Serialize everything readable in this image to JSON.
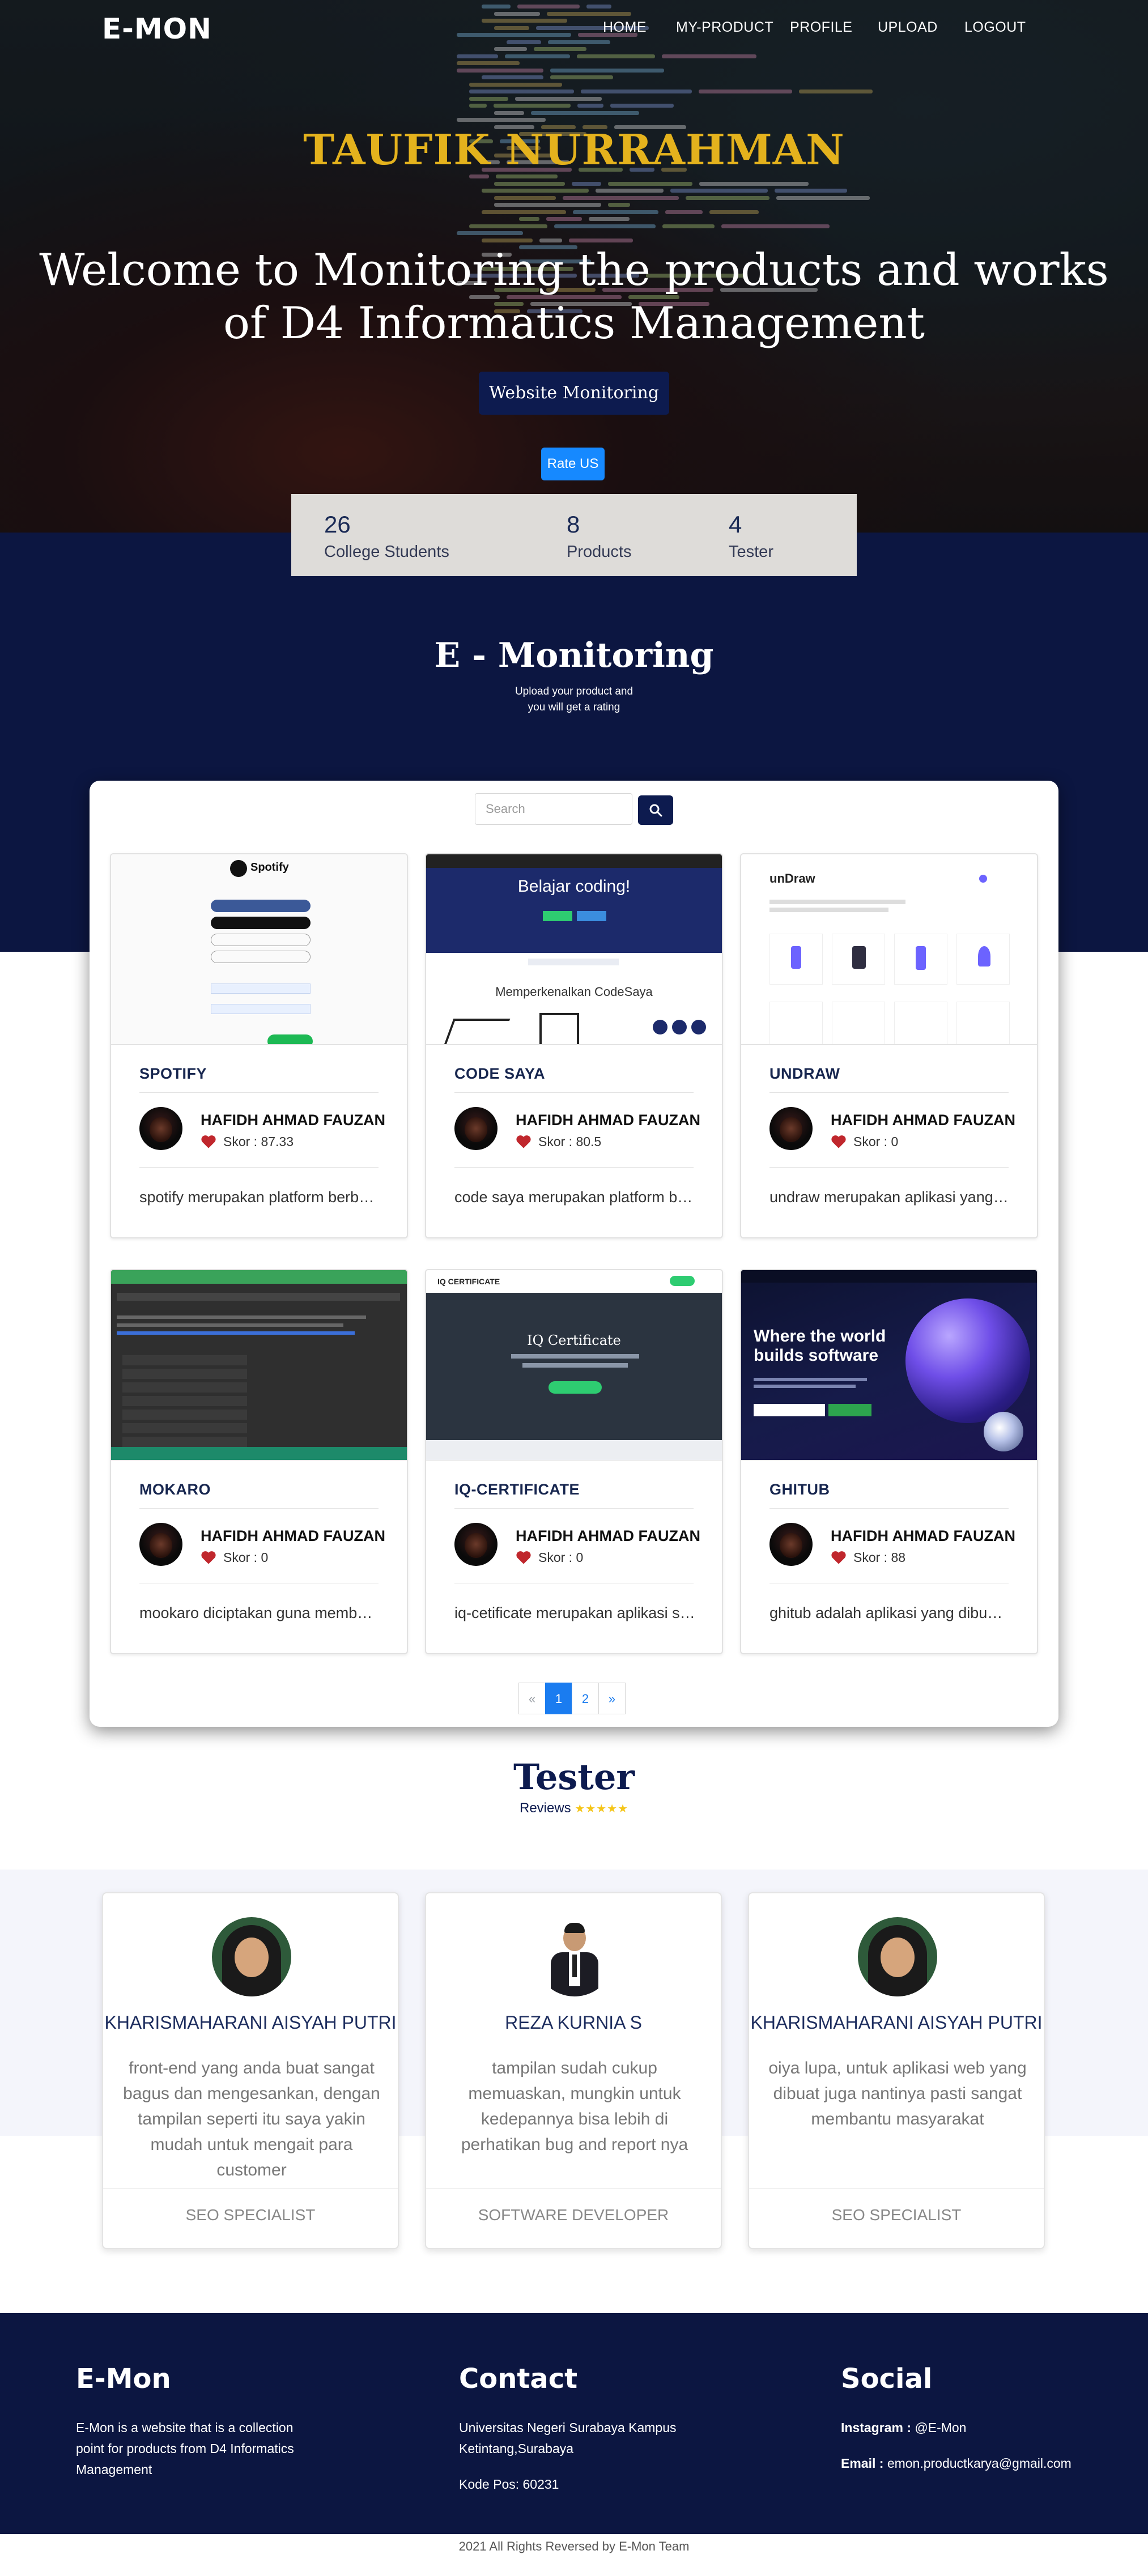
{
  "brand": {
    "logo_text": "E-MON"
  },
  "nav": {
    "items": [
      {
        "label": "HOME"
      },
      {
        "label": "MY-PRODUCT"
      },
      {
        "label": "PROFILE"
      },
      {
        "label": "UPLOAD"
      },
      {
        "label": "LOGOUT"
      }
    ]
  },
  "hero": {
    "name": "TAUFIK NURRAHMAN",
    "title_line1": "Welcome to Monitoring the products and works",
    "title_line2": "of D4 Informatics Management",
    "website_button": "Website Monitoring",
    "rate_button": "Rate US"
  },
  "stats": [
    {
      "value": "26",
      "label": "College Students"
    },
    {
      "value": "8",
      "label": "Products"
    },
    {
      "value": "4",
      "label": "Tester"
    }
  ],
  "monitoring": {
    "title": "E - Monitoring",
    "subtitle_line1": "Upload your product and",
    "subtitle_line2": "you will get a rating"
  },
  "search": {
    "placeholder": "Search",
    "icon": "search-icon"
  },
  "products": [
    {
      "name": "SPOTIFY",
      "owner": "HAFIDH AHMAD FAUZAN",
      "score": "Skor : 87.33",
      "desc": "spotify merupakan platform berbasis musik",
      "thumb": "spotify"
    },
    {
      "name": "CODE SAYA",
      "owner": "HAFIDH AHMAD FAUZAN",
      "score": "Skor : 80.5",
      "desc": "code saya merupakan platform belajar coding",
      "thumb": "codesaya"
    },
    {
      "name": "UNDRAW",
      "owner": "HAFIDH AHMAD FAUZAN",
      "score": "Skor : 0",
      "desc": "undraw merupakan aplikasi yang menyediakan ilustrasi",
      "thumb": "undraw"
    },
    {
      "name": "MOKARO",
      "owner": "HAFIDH AHMAD FAUZAN",
      "score": "Skor : 0",
      "desc": "mookaro diciptakan guna membantu",
      "thumb": "mokaro"
    },
    {
      "name": "IQ-CERTIFICATE",
      "owner": "HAFIDH AHMAD FAUZAN",
      "score": "Skor : 0",
      "desc": "iq-cetificate merupakan aplikasi sertifikat",
      "thumb": "iqcert"
    },
    {
      "name": "GHITUB",
      "owner": "HAFIDH AHMAD FAUZAN",
      "score": "Skor : 88",
      "desc": "ghitub adalah aplikasi yang dibuat untuk",
      "thumb": "github"
    }
  ],
  "thumb_text": {
    "spotify_logo": "Spotify",
    "codesaya_heading": "Belajar coding!",
    "codesaya_sub": "Memperkenalkan CodeSaya",
    "undraw_logo": "unDraw",
    "iqcert_logo": "IQ CERTIFICATE",
    "iqcert_heading": "IQ Certificate",
    "github_heading1": "Where the world",
    "github_heading2": "builds software"
  },
  "pagination": {
    "prev": "«",
    "pages": [
      "1",
      "2"
    ],
    "next": "»",
    "active": "1"
  },
  "tester": {
    "title": "Tester",
    "subtitle": "Reviews",
    "stars": "★★★★★",
    "reviews": [
      {
        "name": "KHARISMAHARANI AISYAH PUTRI",
        "quote": "front-end yang anda buat sangat bagus dan mengesankan, dengan tampilan seperti itu saya yakin mudah untuk mengait para customer",
        "role": "SEO SPECIALIST",
        "photo": "hijab"
      },
      {
        "name": "REZA KURNIA S",
        "quote": "tampilan sudah cukup memuaskan, mungkin untuk kedepannya bisa lebih di perhatikan bug and report nya",
        "role": "SOFTWARE DEVELOPER",
        "photo": "suit"
      },
      {
        "name": "KHARISMAHARANI AISYAH PUTRI",
        "quote": "oiya lupa, untuk aplikasi web yang dibuat juga nantinya pasti sangat membantu masyarakat",
        "role": "SEO SPECIALIST",
        "photo": "hijab"
      }
    ]
  },
  "footer": {
    "about": {
      "title": "E-Mon",
      "text": "E-Mon is a website that is a collection point for products from D4 Informatics Management"
    },
    "contact": {
      "title": "Contact",
      "address": "Universitas Negeri Surabaya Kampus Ketintang,Surabaya",
      "postal": "Kode Pos: 60231"
    },
    "social": {
      "title": "Social",
      "instagram_label": "Instagram :",
      "instagram": "@E-Mon",
      "email_label": "Email :",
      "email": "emon.productkarya@gmail.com"
    },
    "copyright": "2021 All Rights Reversed by E-Mon Team"
  },
  "colors": {
    "navy": "#0c1641",
    "gold": "#e4b21d",
    "accent_blue": "#1a7cf0"
  }
}
